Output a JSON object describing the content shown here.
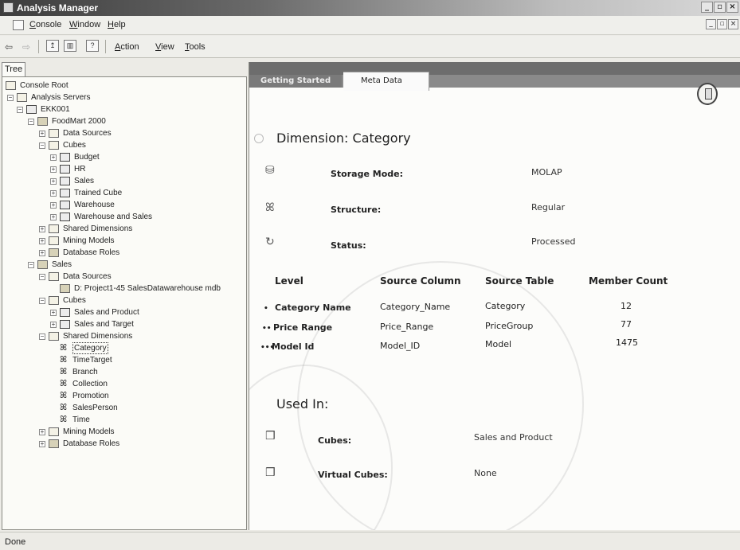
{
  "window": {
    "title": "Analysis Manager"
  },
  "menu": {
    "console": "Console",
    "window": "Window",
    "help": "Help"
  },
  "toolbar": {
    "action": "Action",
    "view": "View",
    "tools": "Tools"
  },
  "tree": {
    "tab_label": "Tree",
    "nodes": [
      {
        "label": "Console Root"
      },
      {
        "label": "Analysis Servers"
      },
      {
        "label": "EKK001"
      },
      {
        "label": "FoodMart 2000"
      },
      {
        "label": "Data Sources"
      },
      {
        "label": "Cubes"
      },
      {
        "label": "Budget"
      },
      {
        "label": "HR"
      },
      {
        "label": "Sales"
      },
      {
        "label": "Trained Cube"
      },
      {
        "label": "Warehouse"
      },
      {
        "label": "Warehouse and Sales"
      },
      {
        "label": "Shared Dimensions"
      },
      {
        "label": "Mining Models"
      },
      {
        "label": "Database Roles"
      },
      {
        "label": "Sales"
      },
      {
        "label": "Data Sources"
      },
      {
        "label": "D: Project1-45 SalesDatawarehouse mdb"
      },
      {
        "label": "Cubes"
      },
      {
        "label": "Sales and Product"
      },
      {
        "label": "Sales and Target"
      },
      {
        "label": "Shared Dimensions"
      },
      {
        "label": "Category"
      },
      {
        "label": "TimeTarget"
      },
      {
        "label": "Branch"
      },
      {
        "label": "Collection"
      },
      {
        "label": "Promotion"
      },
      {
        "label": "SalesPerson"
      },
      {
        "label": "Time"
      },
      {
        "label": "Mining Models"
      },
      {
        "label": "Database Roles"
      }
    ]
  },
  "tabs": {
    "getting_started": "Getting Started",
    "meta_data": "Meta Data"
  },
  "dimension": {
    "title": "Dimension:  Category",
    "storage_label": "Storage Mode:",
    "storage_value": "MOLAP",
    "structure_label": "Structure:",
    "structure_value": "Regular",
    "status_label": "Status:",
    "status_value": "Processed"
  },
  "levels": {
    "headers": [
      "Level",
      "Source Column",
      "Source Table",
      "Member Count"
    ],
    "rows": [
      {
        "level": "Category Name",
        "column": "Category_Name",
        "table": "Category",
        "count": "12"
      },
      {
        "level": "Price Range",
        "column": "Price_Range",
        "table": "PriceGroup",
        "count": "77"
      },
      {
        "level": "Model Id",
        "column": "Model_ID",
        "table": "Model",
        "count": "1475"
      }
    ]
  },
  "used_in": {
    "title": "Used In:",
    "cubes_label": "Cubes:",
    "cubes_value": "Sales and Product",
    "virtual_label": "Virtual Cubes:",
    "virtual_value": "None"
  },
  "status": {
    "text": "Done"
  }
}
